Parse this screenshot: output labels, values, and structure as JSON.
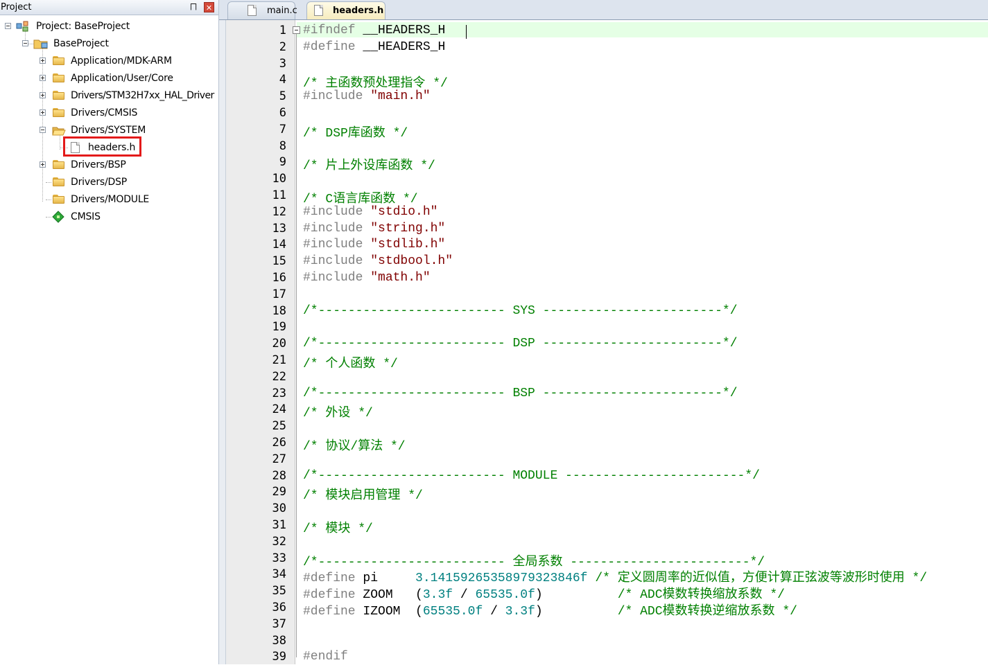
{
  "project_panel": {
    "title": "Project",
    "pin_glyph": "⨅",
    "close_glyph": "✕",
    "tree": [
      {
        "label": "Project: BaseProject",
        "icon": "project-icon",
        "expander": "minus"
      },
      {
        "label": "BaseProject",
        "icon": "target-folder-icon",
        "expander": "minus"
      },
      {
        "label": "Application/MDK-ARM",
        "icon": "folder-icon",
        "expander": "plus"
      },
      {
        "label": "Application/User/Core",
        "icon": "folder-icon",
        "expander": "plus"
      },
      {
        "label": "Drivers/STM32H7xx_HAL_Driver",
        "icon": "folder-icon",
        "expander": "plus"
      },
      {
        "label": "Drivers/CMSIS",
        "icon": "folder-icon",
        "expander": "plus"
      },
      {
        "label": "Drivers/SYSTEM",
        "icon": "open-folder-icon",
        "expander": "minus"
      },
      {
        "label": "headers.h",
        "icon": "file-icon",
        "expander": "none",
        "selected": true
      },
      {
        "label": "Drivers/BSP",
        "icon": "folder-icon",
        "expander": "plus"
      },
      {
        "label": "Drivers/DSP",
        "icon": "folder-icon",
        "expander": "none"
      },
      {
        "label": "Drivers/MODULE",
        "icon": "folder-icon",
        "expander": "none"
      },
      {
        "label": "CMSIS",
        "icon": "green-diamond-icon",
        "expander": "none"
      }
    ]
  },
  "tabs": [
    {
      "label": "main.c",
      "active": false
    },
    {
      "label": "headers.h",
      "active": true
    }
  ],
  "editor": {
    "current_line": 1,
    "lines": [
      {
        "n": "1",
        "parts": [
          {
            "t": "#ifndef ",
            "c": "pre"
          },
          {
            "t": "__HEADERS_H",
            "c": "txt"
          }
        ]
      },
      {
        "n": "2",
        "parts": [
          {
            "t": "#define ",
            "c": "pre"
          },
          {
            "t": "__HEADERS_H",
            "c": "txt"
          }
        ]
      },
      {
        "n": "3",
        "parts": []
      },
      {
        "n": "4",
        "parts": [
          {
            "t": "/* 主函数预处理指令 */",
            "c": "com"
          }
        ]
      },
      {
        "n": "5",
        "parts": [
          {
            "t": "#include ",
            "c": "pre"
          },
          {
            "t": "\"main.h\"",
            "c": "str"
          }
        ]
      },
      {
        "n": "6",
        "parts": []
      },
      {
        "n": "7",
        "parts": [
          {
            "t": "/* DSP库函数 */",
            "c": "com"
          }
        ]
      },
      {
        "n": "8",
        "parts": []
      },
      {
        "n": "9",
        "parts": [
          {
            "t": "/* 片上外设库函数 */",
            "c": "com"
          }
        ]
      },
      {
        "n": "10",
        "parts": []
      },
      {
        "n": "11",
        "parts": [
          {
            "t": "/* C语言库函数 */",
            "c": "com"
          }
        ]
      },
      {
        "n": "12",
        "parts": [
          {
            "t": "#include ",
            "c": "pre"
          },
          {
            "t": "\"stdio.h\"",
            "c": "str"
          }
        ]
      },
      {
        "n": "13",
        "parts": [
          {
            "t": "#include ",
            "c": "pre"
          },
          {
            "t": "\"string.h\"",
            "c": "str"
          }
        ]
      },
      {
        "n": "14",
        "parts": [
          {
            "t": "#include ",
            "c": "pre"
          },
          {
            "t": "\"stdlib.h\"",
            "c": "str"
          }
        ]
      },
      {
        "n": "15",
        "parts": [
          {
            "t": "#include ",
            "c": "pre"
          },
          {
            "t": "\"stdbool.h\"",
            "c": "str"
          }
        ]
      },
      {
        "n": "16",
        "parts": [
          {
            "t": "#include ",
            "c": "pre"
          },
          {
            "t": "\"math.h\"",
            "c": "str"
          }
        ]
      },
      {
        "n": "17",
        "parts": []
      },
      {
        "n": "18",
        "parts": [
          {
            "t": "/*------------------------- SYS ------------------------*/",
            "c": "com"
          }
        ]
      },
      {
        "n": "19",
        "parts": []
      },
      {
        "n": "20",
        "parts": [
          {
            "t": "/*------------------------- DSP ------------------------*/",
            "c": "com"
          }
        ]
      },
      {
        "n": "21",
        "parts": [
          {
            "t": "/* 个人函数 */",
            "c": "com"
          }
        ]
      },
      {
        "n": "22",
        "parts": []
      },
      {
        "n": "23",
        "parts": [
          {
            "t": "/*------------------------- BSP ------------------------*/",
            "c": "com"
          }
        ]
      },
      {
        "n": "24",
        "parts": [
          {
            "t": "/* 外设 */",
            "c": "com"
          }
        ]
      },
      {
        "n": "25",
        "parts": []
      },
      {
        "n": "26",
        "parts": [
          {
            "t": "/* 协议/算法 */",
            "c": "com"
          }
        ]
      },
      {
        "n": "27",
        "parts": []
      },
      {
        "n": "28",
        "parts": [
          {
            "t": "/*------------------------- MODULE ------------------------*/",
            "c": "com"
          }
        ]
      },
      {
        "n": "29",
        "parts": [
          {
            "t": "/* 模块启用管理 */",
            "c": "com"
          }
        ]
      },
      {
        "n": "30",
        "parts": []
      },
      {
        "n": "31",
        "parts": [
          {
            "t": "/* 模块 */",
            "c": "com"
          }
        ]
      },
      {
        "n": "32",
        "parts": []
      },
      {
        "n": "33",
        "parts": [
          {
            "t": "/*------------------------- 全局系数 ------------------------*/",
            "c": "com"
          }
        ]
      },
      {
        "n": "34",
        "parts": [
          {
            "t": "#define ",
            "c": "pre"
          },
          {
            "t": "pi     ",
            "c": "txt"
          },
          {
            "t": "3.14159265358979323846f",
            "c": "num"
          },
          {
            "t": " ",
            "c": "txt"
          },
          {
            "t": "/* 定义圆周率的近似值，方便计算正弦波等波形时使用 */",
            "c": "com"
          }
        ]
      },
      {
        "n": "35",
        "parts": [
          {
            "t": "#define ",
            "c": "pre"
          },
          {
            "t": "ZOOM   (",
            "c": "txt"
          },
          {
            "t": "3.3f",
            "c": "num"
          },
          {
            "t": " / ",
            "c": "txt"
          },
          {
            "t": "65535.0f",
            "c": "num"
          },
          {
            "t": ")          ",
            "c": "txt"
          },
          {
            "t": "/* ADC模数转换缩放系数 */",
            "c": "com"
          }
        ]
      },
      {
        "n": "36",
        "parts": [
          {
            "t": "#define ",
            "c": "pre"
          },
          {
            "t": "IZOOM  (",
            "c": "txt"
          },
          {
            "t": "65535.0f",
            "c": "num"
          },
          {
            "t": " / ",
            "c": "txt"
          },
          {
            "t": "3.3f",
            "c": "num"
          },
          {
            "t": ")          ",
            "c": "txt"
          },
          {
            "t": "/* ADC模数转换逆缩放系数 */",
            "c": "com"
          }
        ]
      },
      {
        "n": "37",
        "parts": []
      },
      {
        "n": "38",
        "parts": []
      },
      {
        "n": "39",
        "parts": [
          {
            "t": "#endif",
            "c": "pre"
          }
        ]
      }
    ]
  },
  "colors": {
    "preprocessor": "#808080",
    "string": "#800000",
    "comment": "#008000",
    "number": "#008080",
    "current_line_highlight": "#e5ffe5",
    "selection_box": "#e31a1a"
  }
}
